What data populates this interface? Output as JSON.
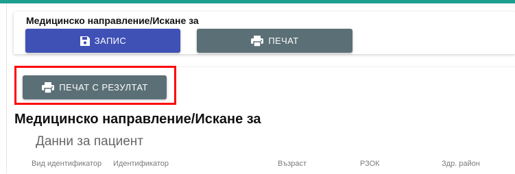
{
  "header_card": {
    "title": "Медицинско направление/Искане за",
    "save_button": {
      "label": "ЗАПИС",
      "icon": "floppy-disk-icon"
    },
    "print_button": {
      "label": "ПЕЧАТ",
      "icon": "printer-icon"
    }
  },
  "print_results_button": {
    "label": "ПЕЧАТ С РЕЗУЛТАТ",
    "icon": "printer-icon"
  },
  "document": {
    "title": "Медицинско направление/Искане за",
    "patient_section": {
      "title": "Данни за пациент",
      "columns": [
        "Вид идентификатор",
        "Идентификатор",
        "Възраст",
        "РЗОК",
        "Здр. район"
      ]
    }
  },
  "colors": {
    "top_bar": "#1e9e8e",
    "save_button": "#3f51b5",
    "print_button": "#5b6f76",
    "highlight": "#ff0000"
  }
}
